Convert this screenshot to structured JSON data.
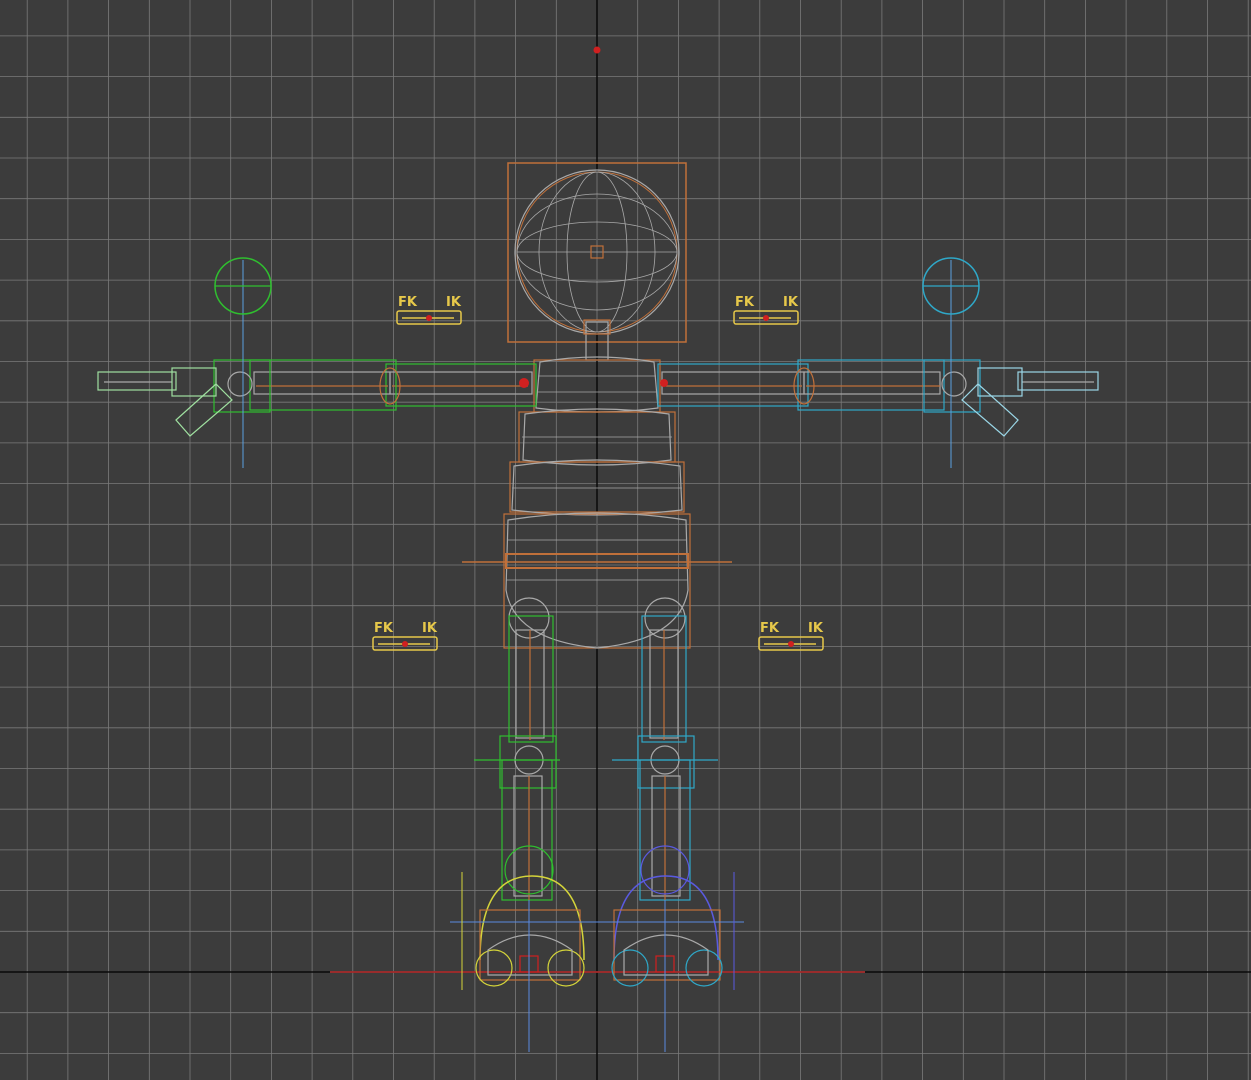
{
  "viewport": {
    "background": "#3c3c3c",
    "grid_color": "#7a7a7a",
    "axis_color": "#0a0a0a"
  },
  "switches": [
    {
      "id": "left-arm",
      "fk": "FK",
      "ik": "IK"
    },
    {
      "id": "right-arm",
      "fk": "FK",
      "ik": "IK"
    },
    {
      "id": "left-leg",
      "fk": "FK",
      "ik": "IK"
    },
    {
      "id": "right-leg",
      "fk": "FK",
      "ik": "IK"
    }
  ],
  "colors": {
    "body": "#c0703a",
    "mesh": "#a9a9a9",
    "left_side": "#2fbf2f",
    "left_hand": "#9fe0a0",
    "right_side": "#2fa8c8",
    "right_hand": "#9ad6e6",
    "switch": "#e6c84a",
    "leg_left": "#d4d43a",
    "leg_right": "#5a5ae0",
    "ground": "#c03030",
    "pivot": "#d02020"
  }
}
